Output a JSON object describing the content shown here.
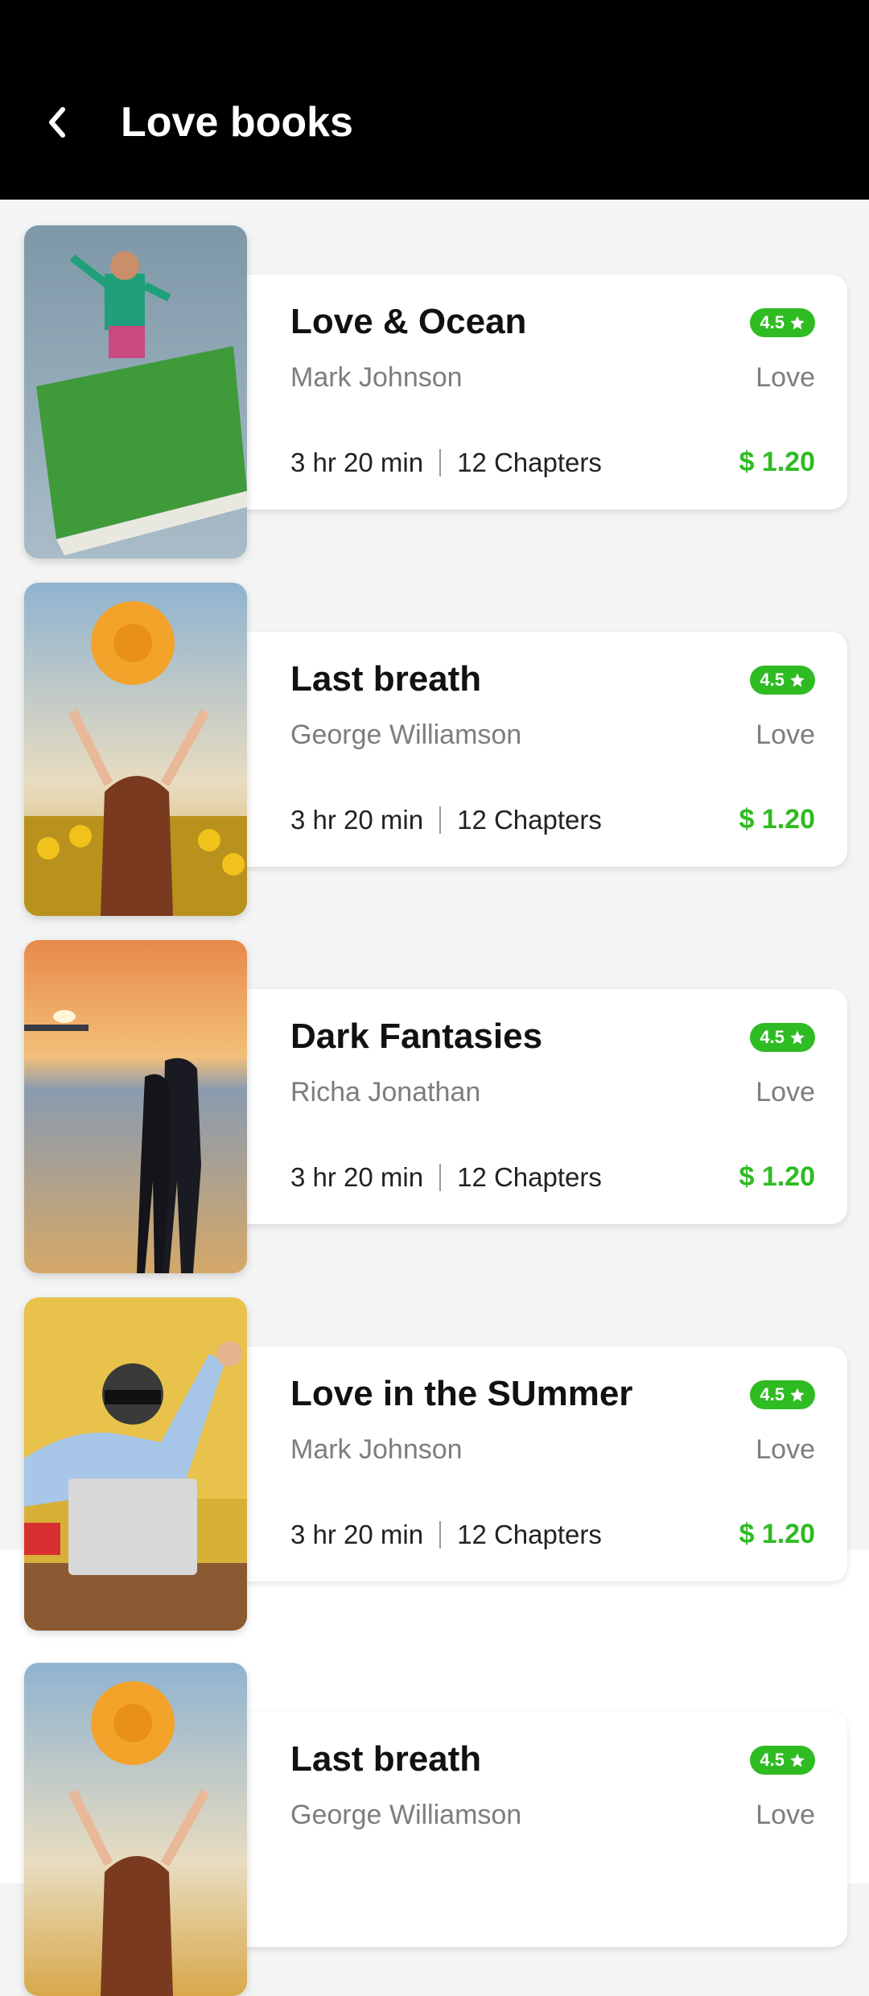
{
  "header": {
    "title": "Love books"
  },
  "colors": {
    "accent": "#2fbb22",
    "appbar": "#000000"
  },
  "books": [
    {
      "title": "Love & Ocean",
      "author": "Mark Johnson",
      "rating": "4.5",
      "genre": "Love",
      "duration": "3 hr 20 min",
      "chapters": "12 Chapters",
      "price": "$ 1.20"
    },
    {
      "title": "Last breath",
      "author": "George Williamson",
      "rating": "4.5",
      "genre": "Love",
      "duration": "3 hr 20 min",
      "chapters": "12 Chapters",
      "price": "$ 1.20"
    },
    {
      "title": "Dark Fantasies",
      "author": "Richa Jonathan",
      "rating": "4.5",
      "genre": "Love",
      "duration": "3 hr 20 min",
      "chapters": "12 Chapters",
      "price": "$ 1.20"
    },
    {
      "title": "Love in the SUmmer",
      "author": "Mark Johnson",
      "rating": "4.5",
      "genre": "Love",
      "duration": "3 hr 20 min",
      "chapters": "12 Chapters",
      "price": "$ 1.20"
    },
    {
      "title": "Last breath",
      "author": "George Williamson",
      "rating": "4.5",
      "genre": "Love"
    }
  ]
}
